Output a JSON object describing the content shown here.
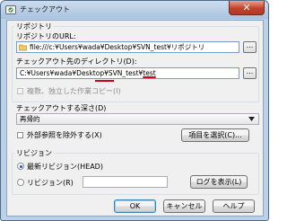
{
  "window": {
    "title": "チェックアウト",
    "close_glyph": "✕"
  },
  "repository": {
    "group_label": "リポジトリ",
    "url_label": "リポジトリのURL:",
    "url_value": "file:///c:¥Users¥wada¥Desktop¥SVN_test¥リポジトリ",
    "checkout_dir_label": "チェックアウト先のディレクトリ(D):",
    "checkout_dir_value_prefix": "C:¥Users¥wada¥Desktop¥SVN_test¥",
    "checkout_dir_value_highlight": "test",
    "highlight_color": "#d0021b",
    "browse_label": "...",
    "independent_copy_label": "複数、独立した作業コピー(I)"
  },
  "depth": {
    "label": "チェックアウトする深さ(D)",
    "selected": "再帰的",
    "omit_externals_label": "外部参照を除外する(X)",
    "choose_items_button": "項目を選択(C)..."
  },
  "revision": {
    "group_label": "リビジョン",
    "head_label": "最新リビジョン(HEAD)",
    "revision_label": "リビジョン(R)",
    "revision_value": "",
    "show_log_button": "ログを表示(L)"
  },
  "buttons": {
    "ok": "OK",
    "cancel": "キャンセル",
    "help": "ヘルプ"
  }
}
